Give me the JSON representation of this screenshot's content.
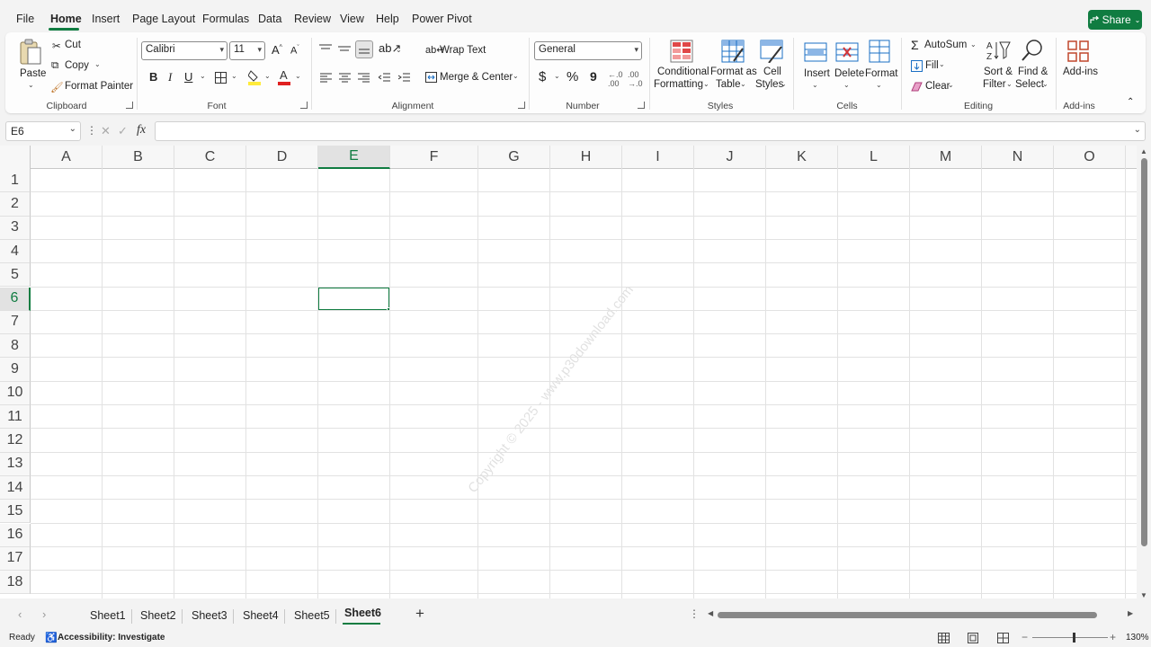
{
  "menu": {
    "items": [
      "File",
      "Home",
      "Insert",
      "Page Layout",
      "Formulas",
      "Data",
      "Review",
      "View",
      "Help",
      "Power Pivot"
    ],
    "active": "Home",
    "share_label": "Share"
  },
  "ribbon": {
    "clipboard": {
      "paste": "Paste",
      "cut": "Cut",
      "copy": "Copy",
      "format_painter": "Format Painter",
      "label": "Clipboard"
    },
    "font": {
      "name": "Calibri",
      "size": "11",
      "bold": "B",
      "italic": "I",
      "underline": "U",
      "label": "Font"
    },
    "alignment": {
      "wrap_text": "Wrap Text",
      "merge_center": "Merge & Center",
      "label": "Alignment"
    },
    "number": {
      "format": "General",
      "currency": "$",
      "percent": "%",
      "comma": "9",
      "label": "Number"
    },
    "styles": {
      "conditional_l1": "Conditional",
      "conditional_l2": "Formatting",
      "format_table_l1": "Format as",
      "format_table_l2": "Table",
      "cell_styles_l1": "Cell",
      "cell_styles_l2": "Styles",
      "label": "Styles"
    },
    "cells": {
      "insert": "Insert",
      "delete": "Delete",
      "format": "Format",
      "label": "Cells"
    },
    "editing": {
      "autosum": "AutoSum",
      "fill": "Fill",
      "clear": "Clear",
      "sort_l1": "Sort &",
      "sort_l2": "Filter",
      "find_l1": "Find &",
      "find_l2": "Select",
      "label": "Editing"
    },
    "addins": {
      "button": "Add-ins",
      "label": "Add-ins"
    }
  },
  "formula_bar": {
    "name_box": "E6",
    "fx": "fx",
    "value": ""
  },
  "grid": {
    "columns": [
      "A",
      "B",
      "C",
      "D",
      "E",
      "F",
      "G",
      "H",
      "I",
      "J",
      "K",
      "L",
      "M",
      "N",
      "O"
    ],
    "rows": [
      "1",
      "2",
      "3",
      "4",
      "5",
      "6",
      "7",
      "8",
      "9",
      "10",
      "11",
      "12",
      "13",
      "14",
      "15",
      "16",
      "17",
      "18"
    ],
    "selected_column": "E",
    "selected_row": "6",
    "watermark": "Copyright © 2025 - www.p30download.com"
  },
  "sheets": {
    "tabs": [
      "Sheet1",
      "Sheet2",
      "Sheet3",
      "Sheet4",
      "Sheet5",
      "Sheet6"
    ],
    "active": "Sheet6",
    "add": "+"
  },
  "status": {
    "ready": "Ready",
    "accessibility": "Accessibility: Investigate",
    "zoom": "130%"
  },
  "colors": {
    "accent": "#107c41",
    "gridline": "#e2e2e2"
  }
}
